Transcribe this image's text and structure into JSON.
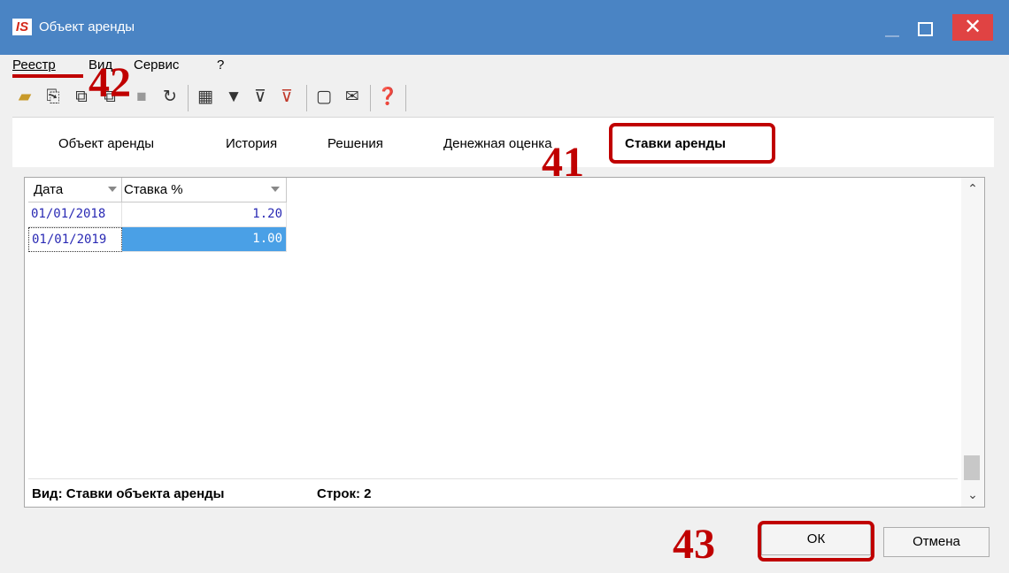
{
  "window": {
    "logo": "IS",
    "title": "Объект аренды",
    "close_glyph": "✕"
  },
  "menu": [
    "Реестр",
    "Вид",
    "Сервис",
    "?"
  ],
  "toolbar_icons": [
    "open-folder-icon",
    "new-item-icon",
    "copy-icon",
    "paste-icon",
    "stop-icon",
    "refresh-icon",
    "table-view-icon",
    "filter-icon",
    "filter-add-icon",
    "filter-clear-icon",
    "card-icon",
    "mail-icon",
    "help-icon"
  ],
  "tabs": [
    "Объект аренды",
    "История",
    "Решения",
    "Денежная оценка",
    "Ставки аренды"
  ],
  "active_tab": "Ставки аренды",
  "grid": {
    "columns": [
      "Дата",
      "Ставка %"
    ],
    "rows": [
      {
        "date": "01/01/2018",
        "rate": "1.20"
      },
      {
        "date": "01/01/2019",
        "rate": "1.00"
      }
    ],
    "selected_row": 2
  },
  "status": {
    "view": "Вид: Ставки объекта аренды",
    "count": "Строк: 2"
  },
  "buttons": {
    "ok": "ОК",
    "cancel": "Отмена"
  },
  "annotations": {
    "a41": "41",
    "a42": "42",
    "a43": "43"
  },
  "colors": {
    "titlebar": "#4a84c4",
    "close": "#e04343",
    "selection": "#4aa0e6",
    "annotation": "#c00000",
    "grid_text": "#2a2ab4"
  }
}
